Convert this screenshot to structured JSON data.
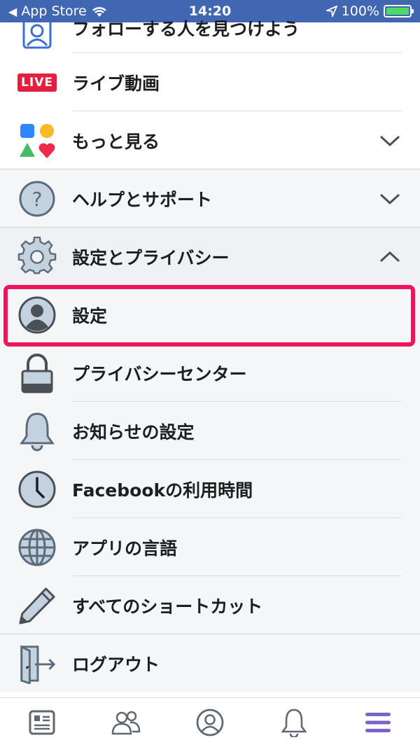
{
  "status_bar": {
    "back_app": "App Store",
    "time": "14:20",
    "battery": "100%",
    "battery_level": 1.0
  },
  "menu": {
    "items": [
      {
        "label": "フォローする人を見つけよう",
        "icon": "find-people-icon"
      },
      {
        "label": "ライブ動画",
        "icon": "live-badge-icon",
        "badge_text": "LIVE"
      },
      {
        "label": "もっと見る",
        "icon": "shapes-icon",
        "expand": "collapsed"
      },
      {
        "label": "ヘルプとサポート",
        "icon": "question-icon",
        "expand": "collapsed"
      },
      {
        "label": "設定とプライバシー",
        "icon": "gear-icon",
        "expand": "expanded"
      },
      {
        "label": "設定",
        "icon": "profile-icon",
        "highlighted": true
      },
      {
        "label": "プライバシーセンター",
        "icon": "lock-icon"
      },
      {
        "label": "お知らせの設定",
        "icon": "bell-icon"
      },
      {
        "label": "Facebookの利用時間",
        "icon": "clock-icon"
      },
      {
        "label": "アプリの言語",
        "icon": "globe-icon"
      },
      {
        "label": "すべてのショートカット",
        "icon": "pencil-icon"
      },
      {
        "label": "ログアウト",
        "icon": "logout-door-icon"
      }
    ]
  },
  "tabbar": {
    "tabs": [
      {
        "name": "news-feed",
        "icon": "news-feed-icon"
      },
      {
        "name": "friends",
        "icon": "friends-icon"
      },
      {
        "name": "profile",
        "icon": "profile-circle-icon"
      },
      {
        "name": "notifications",
        "icon": "bell-tab-icon"
      },
      {
        "name": "menu",
        "icon": "hamburger-icon",
        "active": true
      }
    ]
  },
  "colors": {
    "status_bar_bg": "#4267b2",
    "highlight": "#f0145a",
    "active_tab": "#7b62c9",
    "icon_blue_gray": "#c4d2e0",
    "live_red": "#e41e3f"
  }
}
